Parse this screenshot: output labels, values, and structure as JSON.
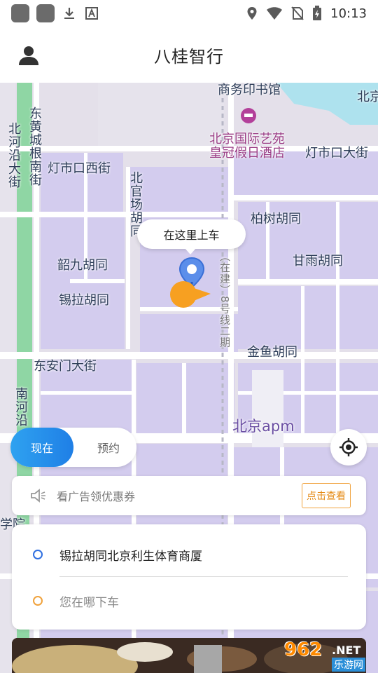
{
  "status_bar": {
    "time": "10:13"
  },
  "header": {
    "title": "八桂智行"
  },
  "map": {
    "labels": {
      "commercial_press": "商务印书馆",
      "bei_top_right": "北京",
      "hotel_line1": "北京国际艺苑",
      "hotel_line2": "皇冠假日酒店",
      "dongshikou_street": "灯市口大街",
      "dengshikou_west": "灯市口西街",
      "bei_hecheng": "北河沿大街",
      "dong_huangcheng": "东黄城根南街",
      "bei_guanchang": "北官场胡同",
      "baishu": "柏树胡同",
      "ganyu": "甘雨胡同",
      "shaojiu": "韶九胡同",
      "xila": "锡拉胡同",
      "metro": "（在建）8号线二期",
      "jinyu": "金鱼胡同",
      "dong_anmen": "东安门大街",
      "nan_heyan": "南河沿",
      "apm": "北京apm",
      "xueyuan": "学院"
    },
    "pickup_bubble": "在这里上车"
  },
  "mode_toggle": {
    "now": "现在",
    "reserve": "预约"
  },
  "ad": {
    "text": "看广告领优惠券",
    "button": "点击查看"
  },
  "route": {
    "pickup": "锡拉胡同北京利生体育商厦",
    "dropoff_placeholder": "您在哪下车"
  },
  "watermark": {
    "num": "962",
    "net": ".NET",
    "cn": "乐游网"
  },
  "colors": {
    "accent_blue": "#1f7fe6",
    "pickup_dot": "#2f6fe0",
    "dropoff_dot": "#f0a23c",
    "map_block": "#d3ccee",
    "map_road": "#ffffff",
    "park_green": "#7fd49a"
  },
  "icons": {
    "profile": "person-icon",
    "locate": "crosshair-icon",
    "ad": "speaker-icon",
    "pin": "location-pin-icon"
  }
}
